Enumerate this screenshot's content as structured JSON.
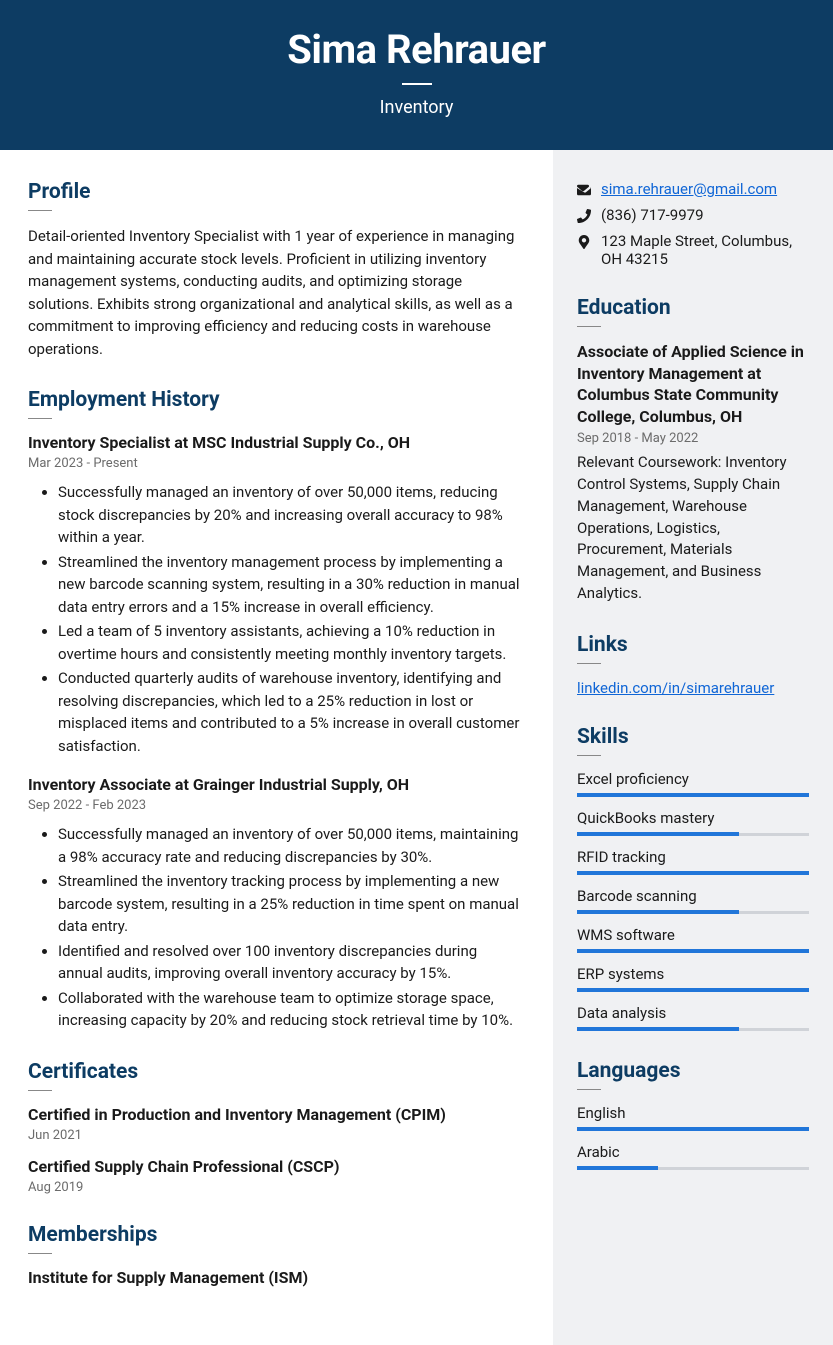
{
  "header": {
    "name": "Sima Rehrauer",
    "subtitle": "Inventory"
  },
  "profile": {
    "heading": "Profile",
    "text": "Detail-oriented Inventory Specialist with 1 year of experience in managing and maintaining accurate stock levels. Proficient in utilizing inventory management systems, conducting audits, and optimizing storage solutions. Exhibits strong organizational and analytical skills, as well as a commitment to improving efficiency and reducing costs in warehouse operations."
  },
  "employment": {
    "heading": "Employment History",
    "jobs": [
      {
        "title": "Inventory Specialist at MSC Industrial Supply Co., OH",
        "date": "Mar 2023 - Present",
        "bullets": [
          "Successfully managed an inventory of over 50,000 items, reducing stock discrepancies by 20% and increasing overall accuracy to 98% within a year.",
          "Streamlined the inventory management process by implementing a new barcode scanning system, resulting in a 30% reduction in manual data entry errors and a 15% increase in overall efficiency.",
          "Led a team of 5 inventory assistants, achieving a 10% reduction in overtime hours and consistently meeting monthly inventory targets.",
          "Conducted quarterly audits of warehouse inventory, identifying and resolving discrepancies, which led to a 25% reduction in lost or misplaced items and contributed to a 5% increase in overall customer satisfaction."
        ]
      },
      {
        "title": "Inventory Associate at Grainger Industrial Supply, OH",
        "date": "Sep 2022 - Feb 2023",
        "bullets": [
          "Successfully managed an inventory of over 50,000 items, maintaining a 98% accuracy rate and reducing discrepancies by 30%.",
          "Streamlined the inventory tracking process by implementing a new barcode system, resulting in a 25% reduction in time spent on manual data entry.",
          "Identified and resolved over 100 inventory discrepancies during annual audits, improving overall inventory accuracy by 15%.",
          "Collaborated with the warehouse team to optimize storage space, increasing capacity by 20% and reducing stock retrieval time by 10%."
        ]
      }
    ]
  },
  "certificates": {
    "heading": "Certificates",
    "items": [
      {
        "title": "Certified in Production and Inventory Management (CPIM)",
        "date": "Jun 2021"
      },
      {
        "title": "Certified Supply Chain Professional (CSCP)",
        "date": "Aug 2019"
      }
    ]
  },
  "memberships": {
    "heading": "Memberships",
    "items": [
      {
        "title": "Institute for Supply Management (ISM)"
      }
    ]
  },
  "contact": {
    "email": "sima.rehrauer@gmail.com",
    "phone": "(836) 717-9979",
    "address": "123 Maple Street, Columbus, OH 43215"
  },
  "education": {
    "heading": "Education",
    "title": "Associate of Applied Science in Inventory Management at Columbus State Community College, Columbus, OH",
    "date": "Sep 2018 - May 2022",
    "text": "Relevant Coursework: Inventory Control Systems, Supply Chain Management, Warehouse Operations, Logistics, Procurement, Materials Management, and Business Analytics."
  },
  "links": {
    "heading": "Links",
    "url": "linkedin.com/in/simarehrauer"
  },
  "skills": {
    "heading": "Skills",
    "items": [
      {
        "name": "Excel proficiency",
        "level": 100
      },
      {
        "name": "QuickBooks mastery",
        "level": 70
      },
      {
        "name": "RFID tracking",
        "level": 100
      },
      {
        "name": "Barcode scanning",
        "level": 70
      },
      {
        "name": "WMS software",
        "level": 100
      },
      {
        "name": "ERP systems",
        "level": 100
      },
      {
        "name": "Data analysis",
        "level": 70
      }
    ]
  },
  "languages": {
    "heading": "Languages",
    "items": [
      {
        "name": "English",
        "level": 100
      },
      {
        "name": "Arabic",
        "level": 35
      }
    ]
  }
}
